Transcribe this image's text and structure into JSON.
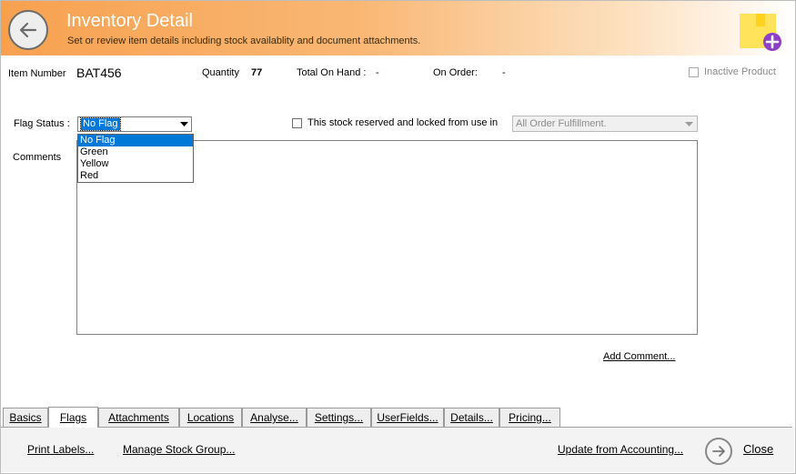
{
  "header": {
    "title": "Inventory Detail",
    "subtitle": "Set or review item details including stock availablity and document attachments."
  },
  "info": {
    "item_number_label": "Item Number",
    "item_number": "BAT456",
    "quantity_label": "Quantity",
    "quantity": "77",
    "total_on_hand_label": "Total On Hand :",
    "total_on_hand": "-",
    "on_order_label": "On Order:",
    "on_order": "-",
    "inactive_label": "Inactive Product",
    "inactive_checked": false
  },
  "flag": {
    "label": "Flag Status :",
    "selected": "No Flag",
    "options": [
      "No Flag",
      "Green",
      "Yellow",
      "Red"
    ]
  },
  "reserve": {
    "label": "This stock reserved and locked from use in",
    "checked": false,
    "scope": "All Order Fulfillment."
  },
  "comments": {
    "label": "Comments",
    "value": "",
    "add_link": "Add Comment..."
  },
  "tabs": [
    {
      "label": "Basics"
    },
    {
      "label": "Flags",
      "active": true
    },
    {
      "label": "Attachments"
    },
    {
      "label": "Locations"
    },
    {
      "label": "Analyse..."
    },
    {
      "label": "Settings..."
    },
    {
      "label": "UserFields..."
    },
    {
      "label": "Details..."
    },
    {
      "label": "Pricing..."
    }
  ],
  "footer": {
    "print_labels": "Print Labels...",
    "manage_stock_group": "Manage Stock Group...",
    "update_from_accounting": "Update from Accounting...",
    "close": "Close"
  },
  "colors": {
    "header_orange": "#f7a14f",
    "selection_blue": "#0078d7",
    "add_icon_purple": "#8e3fc7",
    "sticky_yellow": "#ffe35a"
  }
}
